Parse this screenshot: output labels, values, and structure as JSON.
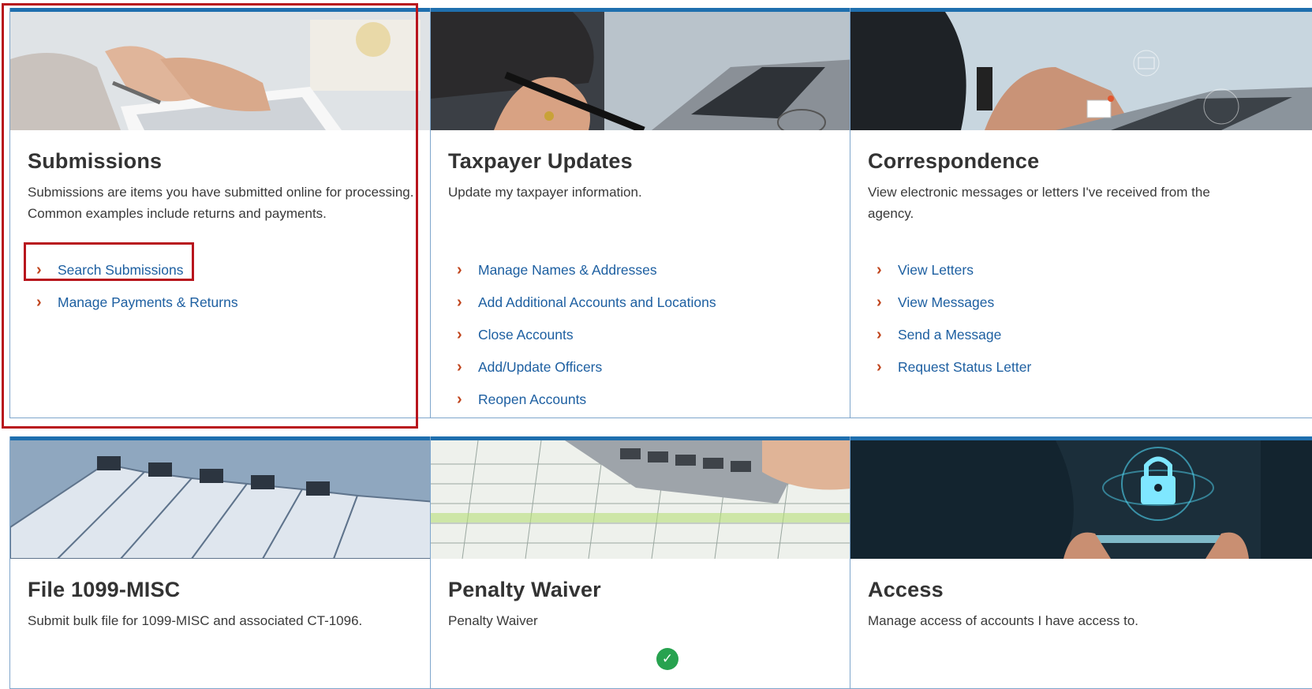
{
  "cards": [
    {
      "title": "Submissions",
      "description": "Submissions are items you have submitted online for processing. Common examples include returns and payments.",
      "links": [
        "Search Submissions",
        "Manage Payments & Returns"
      ]
    },
    {
      "title": "Taxpayer Updates",
      "description": "Update my taxpayer information.",
      "links": [
        "Manage Names & Addresses",
        "Add Additional Accounts and Locations",
        "Close Accounts",
        "Add/Update Officers",
        "Reopen Accounts"
      ]
    },
    {
      "title": "Correspondence",
      "description": "View electronic messages or letters I've received from the agency.",
      "links": [
        "View Letters",
        "View Messages",
        "Send a Message",
        "Request Status Letter"
      ]
    },
    {
      "title": "File 1099-MISC",
      "description": "Submit bulk file for 1099-MISC and associated CT-1096."
    },
    {
      "title": "Penalty Waiver",
      "description": "Penalty Waiver"
    },
    {
      "title": "Access",
      "description": "Manage access of accounts I have access to."
    }
  ],
  "link_chevron": "›",
  "check_glyph": "✓",
  "colors": {
    "accent_bar": "#1f6fae",
    "link": "#1d5fa1",
    "chevron": "#c0451d",
    "highlight": "#b8151d",
    "check": "#27a24f"
  }
}
